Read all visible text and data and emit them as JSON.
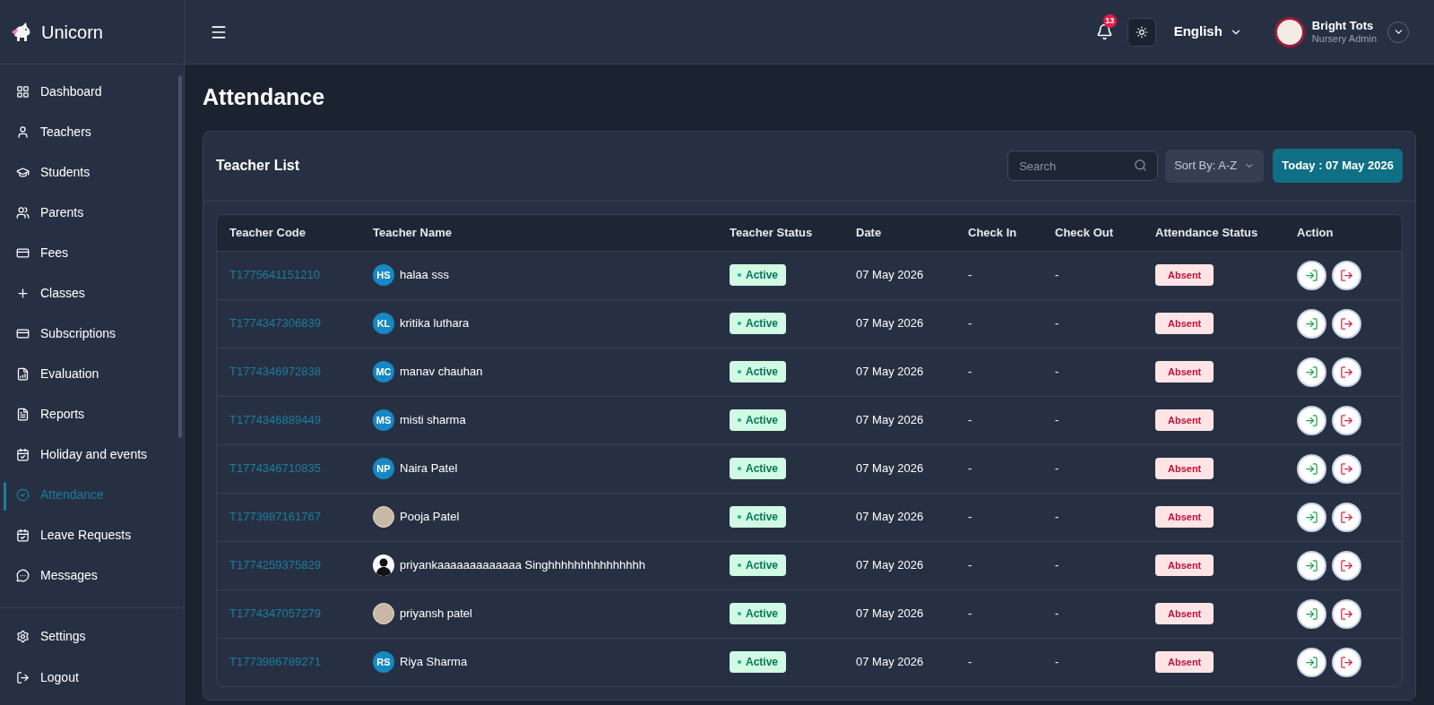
{
  "brand": {
    "name": "Unicorn"
  },
  "sidebar": {
    "items": [
      {
        "label": "Dashboard",
        "selected": false
      },
      {
        "label": "Teachers",
        "selected": false
      },
      {
        "label": "Students",
        "selected": false
      },
      {
        "label": "Parents",
        "selected": false
      },
      {
        "label": "Fees",
        "selected": false
      },
      {
        "label": "Classes",
        "selected": false
      },
      {
        "label": "Subscriptions",
        "selected": false
      },
      {
        "label": "Evaluation",
        "selected": false
      },
      {
        "label": "Reports",
        "selected": false
      },
      {
        "label": "Holiday and events",
        "selected": false
      },
      {
        "label": "Attendance",
        "selected": true
      },
      {
        "label": "Leave Requests",
        "selected": false
      },
      {
        "label": "Messages",
        "selected": false
      }
    ],
    "bottom_items": [
      {
        "label": "Settings"
      },
      {
        "label": "Logout"
      }
    ]
  },
  "header": {
    "notification_count": "13",
    "language": "English",
    "user": {
      "name": "Bright Tots",
      "role": "Nursery Admin"
    }
  },
  "page_title": "Attendance",
  "panel": {
    "title": "Teacher List",
    "search": {
      "placeholder": "Search"
    },
    "sort": "Sort By: A-Z",
    "today": "Today : 07 May 2026"
  },
  "table": {
    "columns": [
      "Teacher Code",
      "Teacher Name",
      "Teacher Status",
      "Date",
      "Check In",
      "Check Out",
      "Attendance Status",
      "Action"
    ],
    "rows": [
      {
        "code": "T1775641151210",
        "avatar": {
          "kind": "initials",
          "text": "HS"
        },
        "name": "halaa sss",
        "status": "Active",
        "date": "07 May 2026",
        "check_in": "-",
        "check_out": "-",
        "attendance": "Absent"
      },
      {
        "code": "T1774347306839",
        "avatar": {
          "kind": "initials",
          "text": "KL"
        },
        "name": "kritika luthara",
        "status": "Active",
        "date": "07 May 2026",
        "check_in": "-",
        "check_out": "-",
        "attendance": "Absent"
      },
      {
        "code": "T1774346972838",
        "avatar": {
          "kind": "initials",
          "text": "MC"
        },
        "name": "manav chauhan",
        "status": "Active",
        "date": "07 May 2026",
        "check_in": "-",
        "check_out": "-",
        "attendance": "Absent"
      },
      {
        "code": "T1774346889449",
        "avatar": {
          "kind": "initials",
          "text": "MS"
        },
        "name": "misti sharma",
        "status": "Active",
        "date": "07 May 2026",
        "check_in": "-",
        "check_out": "-",
        "attendance": "Absent"
      },
      {
        "code": "T1774346710835",
        "avatar": {
          "kind": "initials",
          "text": "NP"
        },
        "name": "Naira Patel",
        "status": "Active",
        "date": "07 May 2026",
        "check_in": "-",
        "check_out": "-",
        "attendance": "Absent"
      },
      {
        "code": "T1773987161767",
        "avatar": {
          "kind": "photo"
        },
        "name": "Pooja Patel",
        "status": "Active",
        "date": "07 May 2026",
        "check_in": "-",
        "check_out": "-",
        "attendance": "Absent"
      },
      {
        "code": "T1774259375829",
        "avatar": {
          "kind": "silhouette"
        },
        "name": "priyankaaaaaaaaaaaaa Singhhhhhhhhhhhhhhh",
        "status": "Active",
        "date": "07 May 2026",
        "check_in": "-",
        "check_out": "-",
        "attendance": "Absent"
      },
      {
        "code": "T1774347057279",
        "avatar": {
          "kind": "photo"
        },
        "name": "priyansh patel",
        "status": "Active",
        "date": "07 May 2026",
        "check_in": "-",
        "check_out": "-",
        "attendance": "Absent"
      },
      {
        "code": "T1773986789271",
        "avatar": {
          "kind": "initials",
          "text": "RS"
        },
        "name": "Riya Sharma",
        "status": "Active",
        "date": "07 May 2026",
        "check_in": "-",
        "check_out": "-",
        "attendance": "Absent"
      }
    ]
  }
}
